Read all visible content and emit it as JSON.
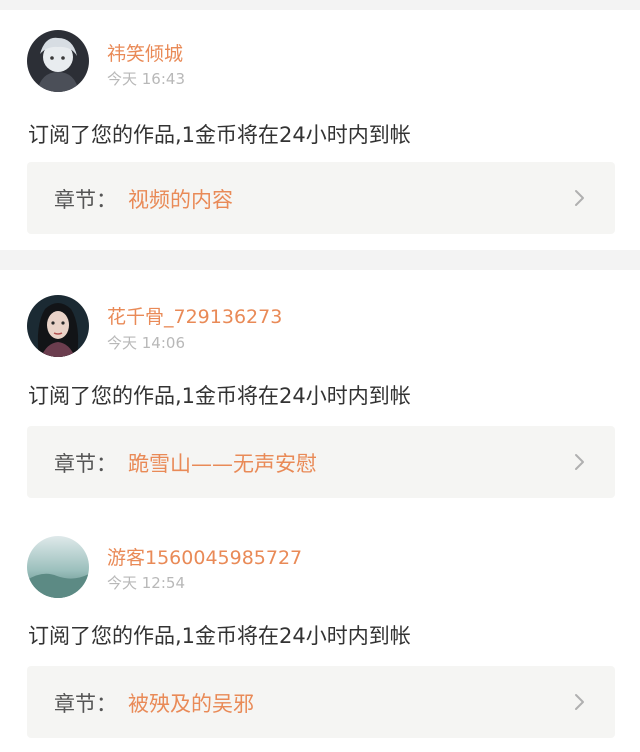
{
  "notifications": [
    {
      "username": "祎笑倾城",
      "time": "今天 16:43",
      "message": "订阅了您的作品,1金币将在24小时内到帐",
      "chapter_prefix": "章节：",
      "chapter_title": "视频的内容"
    },
    {
      "username": "花千骨_729136273",
      "time": "今天 14:06",
      "message": "订阅了您的作品,1金币将在24小时内到帐",
      "chapter_prefix": "章节：",
      "chapter_title": "跪雪山——无声安慰"
    },
    {
      "username": "游客1560045985727",
      "time": "今天 12:54",
      "message": "订阅了您的作品,1金币将在24小时内到帐",
      "chapter_prefix": "章节：",
      "chapter_title": "被殃及的吴邪"
    }
  ],
  "colors": {
    "accent": "#e98a57",
    "text": "#333333",
    "muted": "#b8b8b8",
    "chip_bg": "#f5f5f3",
    "divider": "#f3f3f3"
  },
  "icons": {
    "chevron": "chevron-right-icon"
  }
}
